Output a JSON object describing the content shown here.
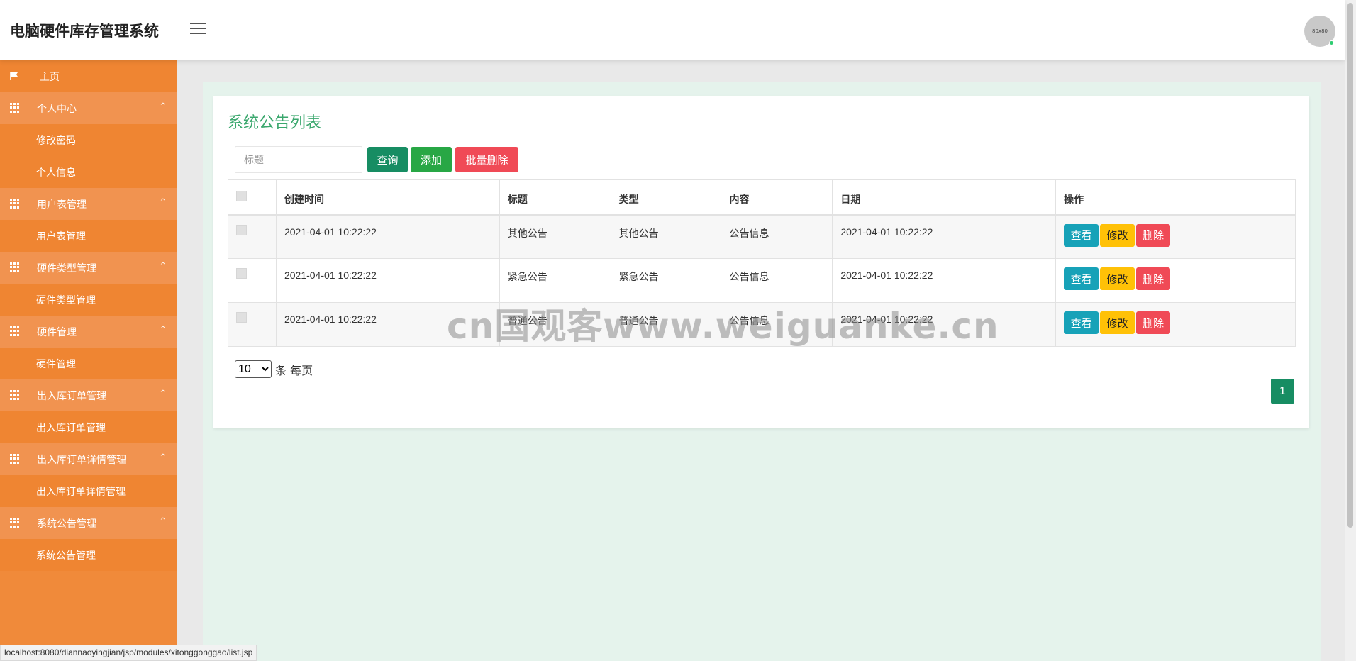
{
  "app": {
    "title": "电脑硬件库存管理系统",
    "avatar_text": "80x80"
  },
  "sidebar": {
    "home": "主页",
    "groups": [
      {
        "label": "个人中心",
        "arrow": "^",
        "children": [
          "修改密码",
          "个人信息"
        ]
      },
      {
        "label": "用户表管理",
        "arrow": "^",
        "children": [
          "用户表管理"
        ]
      },
      {
        "label": "硬件类型管理",
        "arrow": "^",
        "children": [
          "硬件类型管理"
        ]
      },
      {
        "label": "硬件管理",
        "arrow": "^",
        "children": [
          "硬件管理"
        ]
      },
      {
        "label": "出入库订单管理",
        "arrow": "^",
        "children": [
          "出入库订单管理"
        ]
      },
      {
        "label": "出入库订单详情管理",
        "arrow": "^",
        "children": [
          "出入库订单详情管理"
        ]
      },
      {
        "label": "系统公告管理",
        "arrow": "^",
        "children": [
          "系统公告管理"
        ]
      }
    ]
  },
  "main": {
    "card_title": "系统公告列表",
    "search_placeholder": "标题",
    "buttons": {
      "query": "查询",
      "add": "添加",
      "batch_delete": "批量删除"
    },
    "table": {
      "headers": [
        "创建时间",
        "标题",
        "类型",
        "内容",
        "日期",
        "操作"
      ],
      "rows": [
        {
          "created": "2021-04-01 10:22:22",
          "title": "其他公告",
          "type": "其他公告",
          "content": "公告信息",
          "date": "2021-04-01 10:22:22"
        },
        {
          "created": "2021-04-01 10:22:22",
          "title": "紧急公告",
          "type": "紧急公告",
          "content": "公告信息",
          "date": "2021-04-01 10:22:22"
        },
        {
          "created": "2021-04-01 10:22:22",
          "title": "普通公告",
          "type": "普通公告",
          "content": "公告信息",
          "date": "2021-04-01 10:22:22"
        }
      ],
      "actions": {
        "view": "查看",
        "edit": "修改",
        "delete": "删除"
      }
    },
    "pagination": {
      "page_size": "10",
      "page_size_label": "条 每页",
      "current_page": "1"
    }
  },
  "watermark": "cn国观客www.weiguanke.cn",
  "status_bar": {
    "url": "localhost:8080/diannaoyingjian/jsp/modules/xitonggonggao/list.jsp"
  },
  "colors": {
    "sidebar": "#f08a3a",
    "accent_green": "#178d63",
    "title_green": "#3aa76d",
    "danger": "#f04a56",
    "info": "#17a2b8",
    "warning": "#ffc107"
  }
}
